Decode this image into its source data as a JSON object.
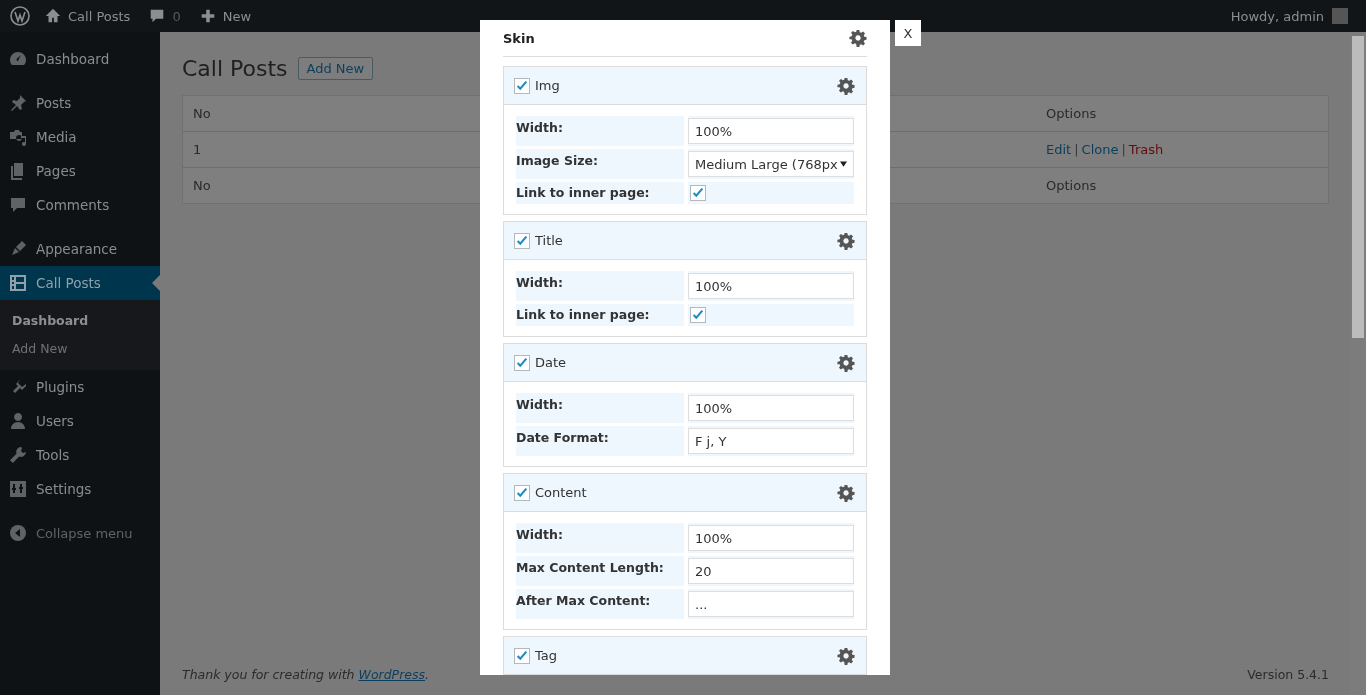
{
  "admin_bar": {
    "site": "Call Posts",
    "comments": "0",
    "new": "New",
    "greeting": "Howdy, admin"
  },
  "sidebar": {
    "groups": [
      [
        {
          "label": "Dashboard",
          "selected": false
        }
      ],
      [
        {
          "label": "Posts",
          "selected": false
        },
        {
          "label": "Media",
          "selected": false
        },
        {
          "label": "Pages",
          "selected": false
        },
        {
          "label": "Comments",
          "selected": false
        }
      ],
      [
        {
          "label": "Appearance",
          "selected": false
        },
        {
          "label": "Call Posts",
          "selected": true,
          "children": [
            {
              "label": "Dashboard",
              "selected": true
            },
            {
              "label": "Add New",
              "selected": false
            }
          ]
        },
        {
          "label": "Plugins",
          "selected": false
        },
        {
          "label": "Users",
          "selected": false
        },
        {
          "label": "Tools",
          "selected": false
        },
        {
          "label": "Settings",
          "selected": false
        }
      ]
    ],
    "collapse": "Collapse menu"
  },
  "page": {
    "title": "Call Posts",
    "add_button": "Add New"
  },
  "table": {
    "header": [
      "No",
      "Options"
    ],
    "rows": [
      {
        "no": "1",
        "separator": "|",
        "actions": [
          {
            "label": "Edit",
            "kind": "link"
          },
          {
            "label": "Clone",
            "kind": "link"
          },
          {
            "label": "Trash",
            "kind": "delete"
          }
        ]
      }
    ],
    "footer": [
      "No",
      "Options"
    ]
  },
  "footer": {
    "before": "Thank you for creating with ",
    "link": "WordPress",
    "after": ".",
    "version": "Version 5.4.1"
  },
  "modal": {
    "title": "Skin",
    "close": "X",
    "sections": [
      {
        "label": "Img",
        "checked": true,
        "fields": [
          {
            "label": "Width:",
            "kind": "text",
            "value": "100%"
          },
          {
            "label": "Image Size:",
            "kind": "select",
            "value": "Medium Large (768px"
          },
          {
            "label": "Link to inner page:",
            "kind": "checkbox",
            "checked": true
          }
        ]
      },
      {
        "label": "Title",
        "checked": true,
        "fields": [
          {
            "label": "Width:",
            "kind": "text",
            "value": "100%"
          },
          {
            "label": "Link to inner page:",
            "kind": "checkbox",
            "checked": true
          }
        ]
      },
      {
        "label": "Date",
        "checked": true,
        "fields": [
          {
            "label": "Width:",
            "kind": "text",
            "value": "100%"
          },
          {
            "label": "Date Format:",
            "kind": "text",
            "value": "F j, Y"
          }
        ]
      },
      {
        "label": "Content",
        "checked": true,
        "fields": [
          {
            "label": "Width:",
            "kind": "text",
            "value": "100%"
          },
          {
            "label": "Max Content Length:",
            "kind": "text",
            "value": "20"
          },
          {
            "label": "After Max Content:",
            "kind": "text",
            "value": "..."
          }
        ]
      },
      {
        "label": "Tag",
        "checked": true
      }
    ]
  }
}
